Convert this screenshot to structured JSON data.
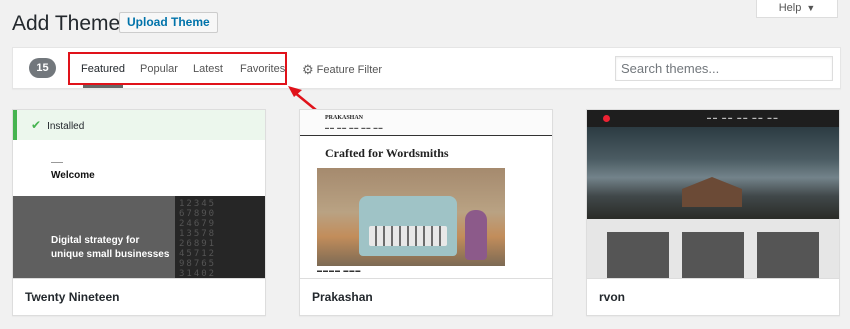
{
  "header": {
    "title": "Add Themes",
    "upload_label": "Upload Theme",
    "help_label": "Help"
  },
  "filter_bar": {
    "count": "15",
    "tabs": [
      {
        "label": "Featured",
        "current": true
      },
      {
        "label": "Popular",
        "current": false
      },
      {
        "label": "Latest",
        "current": false
      },
      {
        "label": "Favorites",
        "current": false
      }
    ],
    "feature_filter_label": "Feature Filter",
    "search_placeholder": "Search themes..."
  },
  "annotation": {
    "highlight_color": "#e0121a"
  },
  "themes": [
    {
      "name": "Twenty Nineteen",
      "installed_label": "Installed",
      "preview": {
        "heading": "Welcome",
        "tagline_line1": "Digital strategy for",
        "tagline_line2": "unique small businesses"
      }
    },
    {
      "name": "Prakashan",
      "preview": {
        "logo": "PRAKASHAN",
        "headline": "Crafted for Wordsmiths"
      }
    },
    {
      "name": "rvon"
    }
  ],
  "colors": {
    "accent": "#0073aa",
    "installed_green": "#46b450",
    "count_badge": "#72777c"
  }
}
